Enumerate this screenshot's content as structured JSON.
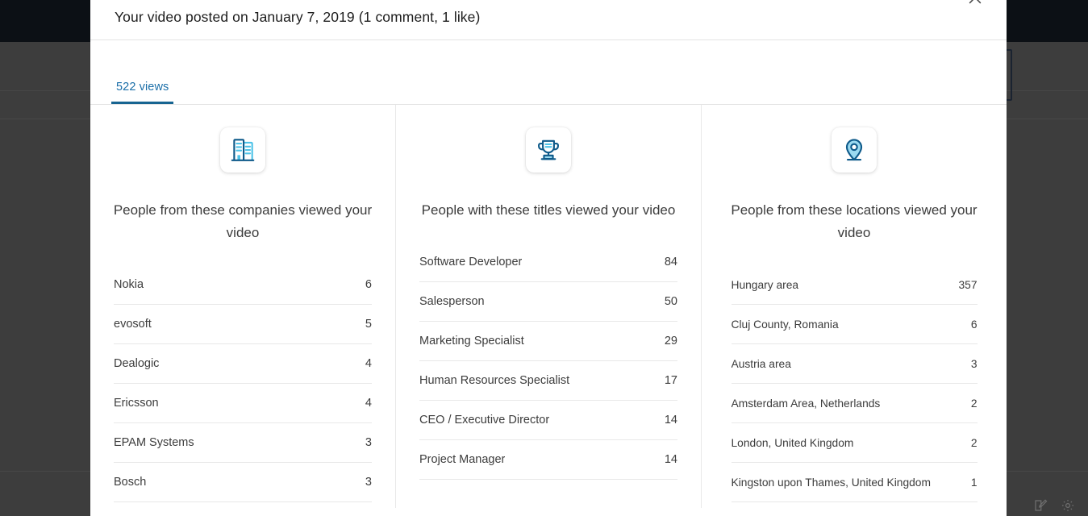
{
  "modal": {
    "title": "Your video posted on January 7, 2019 (1 comment, 1 like)",
    "close_label": "×"
  },
  "tabs": [
    {
      "label": "522 views",
      "active": true
    }
  ],
  "columns": [
    {
      "icon": "company-building-icon",
      "heading": "People from these companies viewed your video",
      "rows": [
        {
          "label": "Nokia",
          "value": "6"
        },
        {
          "label": "evosoft",
          "value": "5"
        },
        {
          "label": "Dealogic",
          "value": "4"
        },
        {
          "label": "Ericsson",
          "value": "4"
        },
        {
          "label": "EPAM Systems",
          "value": "3"
        },
        {
          "label": "Bosch",
          "value": "3"
        }
      ]
    },
    {
      "icon": "trophy-icon",
      "heading": "People with these titles viewed your video",
      "rows": [
        {
          "label": "Software Developer",
          "value": "84"
        },
        {
          "label": "Salesperson",
          "value": "50"
        },
        {
          "label": "Marketing Specialist",
          "value": "29"
        },
        {
          "label": "Human Resources Specialist",
          "value": "17"
        },
        {
          "label": "CEO / Executive Director",
          "value": "14"
        },
        {
          "label": "Project Manager",
          "value": "14"
        }
      ]
    },
    {
      "icon": "location-pin-icon",
      "heading": "People from these locations viewed your video",
      "rows": [
        {
          "label": "Hungary area",
          "value": "357"
        },
        {
          "label": "Cluj County, Romania",
          "value": "6"
        },
        {
          "label": "Austria area",
          "value": "3"
        },
        {
          "label": "Amsterdam Area, Netherlands",
          "value": "2"
        },
        {
          "label": "London, United Kingdom",
          "value": "2"
        },
        {
          "label": "Kingston upon Thames, United Kingdom",
          "value": "1"
        }
      ]
    }
  ],
  "colors": {
    "accent": "#176491",
    "icon_dark": "#0e5a8a",
    "icon_light": "#4fc3e8",
    "text": "#3c3c3c",
    "divider": "#e8e8e8",
    "backdrop": "#3d3d3d",
    "topbar": "#0c1015"
  }
}
